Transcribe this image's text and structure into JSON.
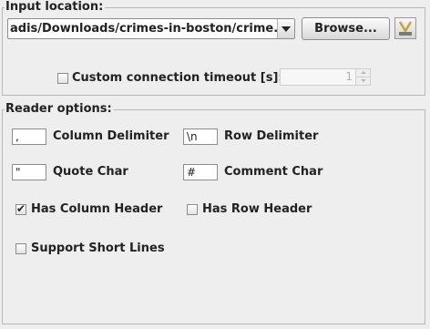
{
  "input_location": {
    "legend": "Input location:",
    "path_value": "adis/Downloads/crimes-in-boston/crime.csv",
    "browse_label": "Browse...",
    "custom_timeout_label": "Custom connection timeout [s]:",
    "custom_timeout_checked": false,
    "timeout_value": "1"
  },
  "reader_options": {
    "legend": "Reader options:",
    "column_delimiter": {
      "label": "Column Delimiter",
      "value": ","
    },
    "row_delimiter": {
      "label": "Row Delimiter",
      "value": "\\n"
    },
    "quote_char": {
      "label": "Quote Char",
      "value": "\""
    },
    "comment_char": {
      "label": "Comment Char",
      "value": "#"
    },
    "has_column_header": {
      "label": "Has Column Header",
      "checked": true,
      "mark": "✔"
    },
    "has_row_header": {
      "label": "Has Row Header",
      "checked": false
    },
    "support_short_lines": {
      "label": "Support Short Lines",
      "checked": false
    }
  }
}
